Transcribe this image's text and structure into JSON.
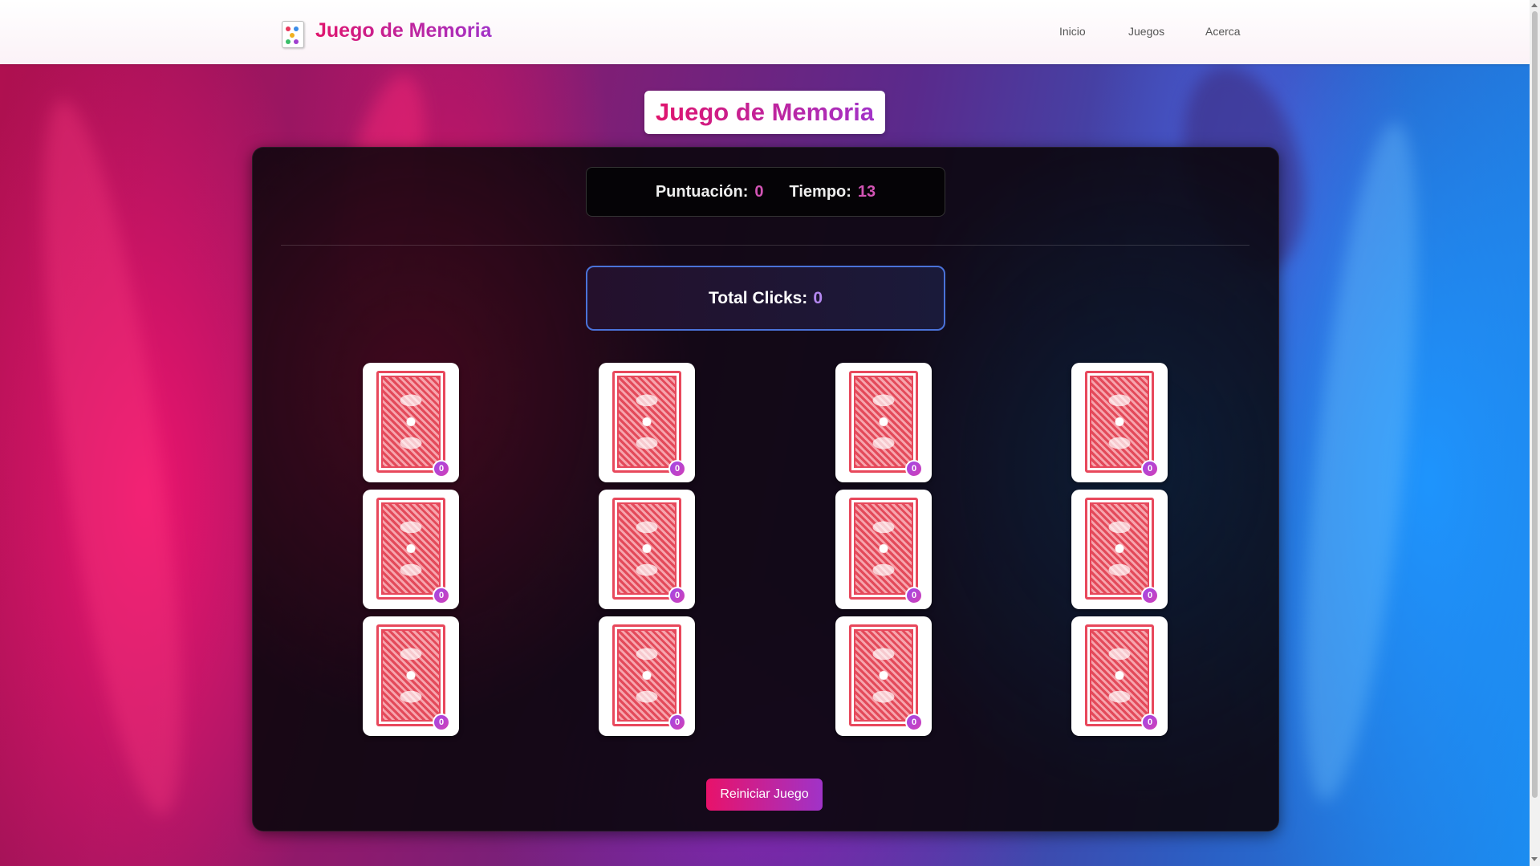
{
  "navbar": {
    "brand_title": "Juego de Memoria",
    "links": [
      "Inicio",
      "Juegos",
      "Acerca"
    ]
  },
  "page": {
    "title": "Juego de Memoria"
  },
  "stats": {
    "score_label": "Puntuación:",
    "score_value": "0",
    "time_label": "Tiempo:",
    "time_value": "13"
  },
  "clicks": {
    "label": "Total Clicks:",
    "value": "0"
  },
  "cards": [
    {
      "clicks": "0"
    },
    {
      "clicks": "0"
    },
    {
      "clicks": "0"
    },
    {
      "clicks": "0"
    },
    {
      "clicks": "0"
    },
    {
      "clicks": "0"
    },
    {
      "clicks": "0"
    },
    {
      "clicks": "0"
    },
    {
      "clicks": "0"
    },
    {
      "clicks": "0"
    },
    {
      "clicks": "0"
    },
    {
      "clicks": "0"
    }
  ],
  "restart_label": "Reiniciar Juego",
  "colors": {
    "brand_gradient_start": "#e0156d",
    "brand_gradient_end": "#a232c8",
    "accent_value": "#d254b4",
    "clicks_border": "#4a72d8",
    "card_back_red": "#e0445a"
  }
}
